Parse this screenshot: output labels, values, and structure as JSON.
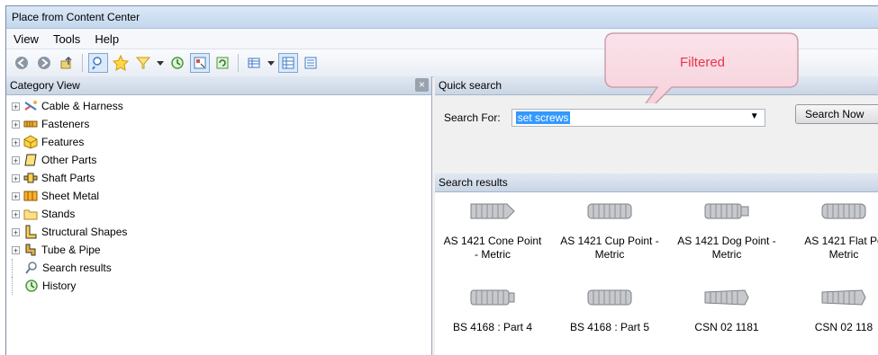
{
  "window": {
    "title": "Place from Content Center"
  },
  "menu": [
    "View",
    "Tools",
    "Help"
  ],
  "toolbar_icons": [
    "back-icon",
    "forward-icon",
    "up-icon",
    "search-toggle-icon",
    "favorites-icon",
    "filter-icon",
    "dropdown-arrow-icon",
    "history-icon",
    "view-mode-icon",
    "refresh-icon",
    "table-view-icon",
    "dropdown-arrow-icon",
    "detail-view-icon",
    "list-view-icon"
  ],
  "category_view": {
    "title": "Category View",
    "close": "×",
    "items": [
      {
        "label": "Cable & Harness",
        "icon": "cable-harness-icon",
        "expandable": true
      },
      {
        "label": "Fasteners",
        "icon": "fasteners-icon",
        "expandable": true
      },
      {
        "label": "Features",
        "icon": "features-icon",
        "expandable": true
      },
      {
        "label": "Other Parts",
        "icon": "other-parts-icon",
        "expandable": true
      },
      {
        "label": "Shaft Parts",
        "icon": "shaft-parts-icon",
        "expandable": true
      },
      {
        "label": "Sheet Metal",
        "icon": "sheet-metal-icon",
        "expandable": true
      },
      {
        "label": "Stands",
        "icon": "folder-icon",
        "expandable": true
      },
      {
        "label": "Structural Shapes",
        "icon": "structural-shapes-icon",
        "expandable": true
      },
      {
        "label": "Tube & Pipe",
        "icon": "tube-pipe-icon",
        "expandable": true
      },
      {
        "label": "Search results",
        "icon": "search-results-icon",
        "expandable": false
      },
      {
        "label": "History",
        "icon": "history-icon",
        "expandable": false
      }
    ]
  },
  "quick_search": {
    "title": "Quick search",
    "label": "Search For:",
    "value": "set screws",
    "button": "Search Now"
  },
  "search_results": {
    "title": "Search results",
    "items": [
      {
        "line1": "AS 1421 Cone Point",
        "line2": "- Metric"
      },
      {
        "line1": "AS 1421 Cup Point -",
        "line2": "Metric"
      },
      {
        "line1": "AS 1421 Dog Point -",
        "line2": "Metric"
      },
      {
        "line1": "AS 1421 Flat Po",
        "line2": "Metric"
      },
      {
        "line1": "BS 4168 : Part 4",
        "line2": ""
      },
      {
        "line1": "BS 4168 : Part 5",
        "line2": ""
      },
      {
        "line1": "CSN 02 1181",
        "line2": ""
      },
      {
        "line1": "CSN 02 118",
        "line2": ""
      }
    ]
  },
  "callout": {
    "text": "Filtered",
    "color": "#e8344b"
  }
}
